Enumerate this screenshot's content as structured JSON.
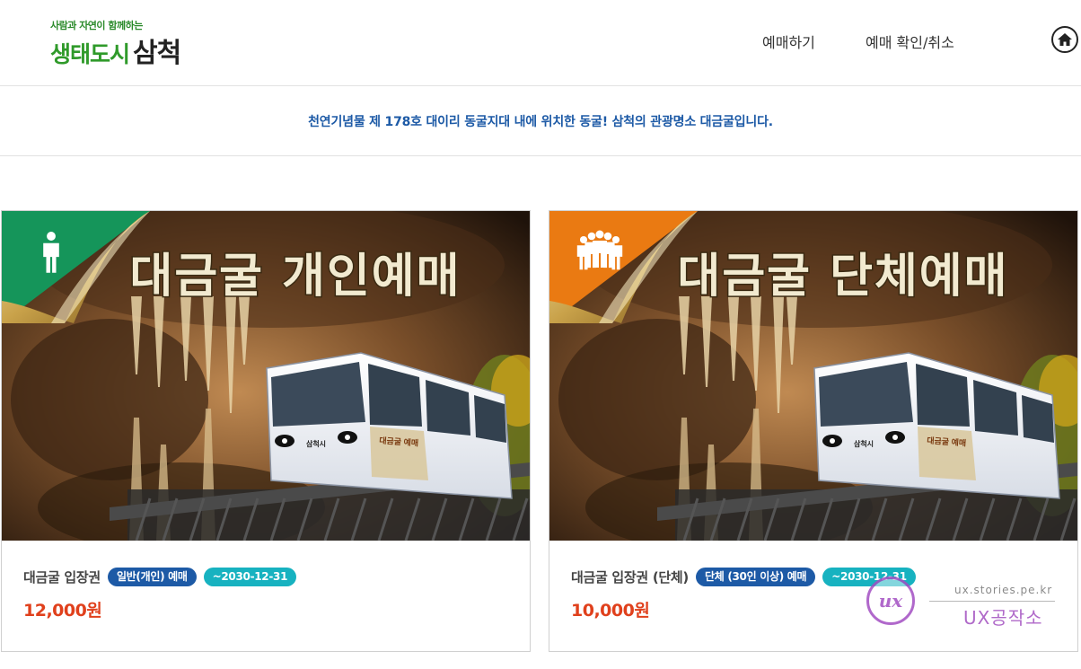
{
  "header": {
    "logo": {
      "tagline": "사람과 자연이 함께하는",
      "name_green": "생태도시",
      "name_dark": "삼척"
    },
    "nav": {
      "book": "예매하기",
      "check": "예매 확인/취소"
    },
    "home_icon": "home-icon"
  },
  "banner": {
    "text": "천연기념물 제 178호 대이리 동굴지대 내에 위치한 동굴! 삼척의 관광명소 대금굴입니다."
  },
  "products": [
    {
      "image_title": "대금굴 개인예매",
      "train_label": "삼척시",
      "train_side_label": "대금굴 예매",
      "corner_icon": "person-icon",
      "corner_color": "#15955a",
      "name": "대금굴 입장권",
      "type_badge": "일반(개인) 예매",
      "date_badge": "~2030-12-31",
      "price": "12,000원"
    },
    {
      "image_title": "대금굴 단체예매",
      "train_label": "삼척시",
      "train_side_label": "대금굴 예매",
      "corner_icon": "group-icon",
      "corner_color": "#ea7a12",
      "name": "대금굴 입장권 (단체)",
      "type_badge": "단체 (30인 이상) 예매",
      "date_badge": "~2030-12-31",
      "price": "10,000원"
    }
  ],
  "watermark": {
    "mark": "ux",
    "url": "ux.stories.pe.kr",
    "name": "UX공작소"
  },
  "colors": {
    "accent_blue": "#1d5aa6",
    "badge_teal": "#17b2c0",
    "price_red": "#e0401c"
  }
}
